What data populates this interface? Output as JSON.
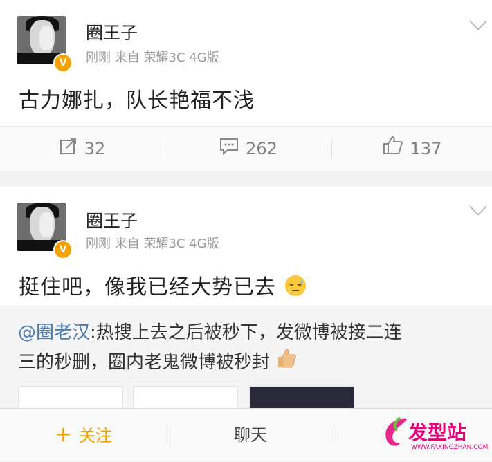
{
  "posts": [
    {
      "username": "圈王子",
      "meta": "刚刚 来自 荣耀3C 4G版",
      "content": "古力娜扎，队长艳福不浅",
      "verified_badge": "V",
      "actions": {
        "repost_count": "32",
        "comment_count": "262",
        "like_count": "137"
      }
    },
    {
      "username": "圈王子",
      "meta": "刚刚 来自 荣耀3C 4G版",
      "content": "挺住吧，像我已经大势已去",
      "verified_badge": "V",
      "emoji": "sweat-face-icon",
      "repost": {
        "mention": "@圈老汉",
        "text_line1": ":热搜上去之后被秒下，发微博被接二连",
        "text_line2": "三的秒删，圈内老鬼微博被秒封",
        "emoji": "thumbs-up-icon"
      }
    }
  ],
  "bottom_bar": {
    "follow_label": "关注",
    "follow_icon": "+",
    "chat_label": "聊天"
  },
  "watermark": {
    "text": "发型站",
    "url": "WWW.FAXINGZHAN.COM"
  },
  "colors": {
    "accent_orange": "#f0a000",
    "mention_blue": "#4a7bb3",
    "watermark_pink": "#e6007e"
  }
}
